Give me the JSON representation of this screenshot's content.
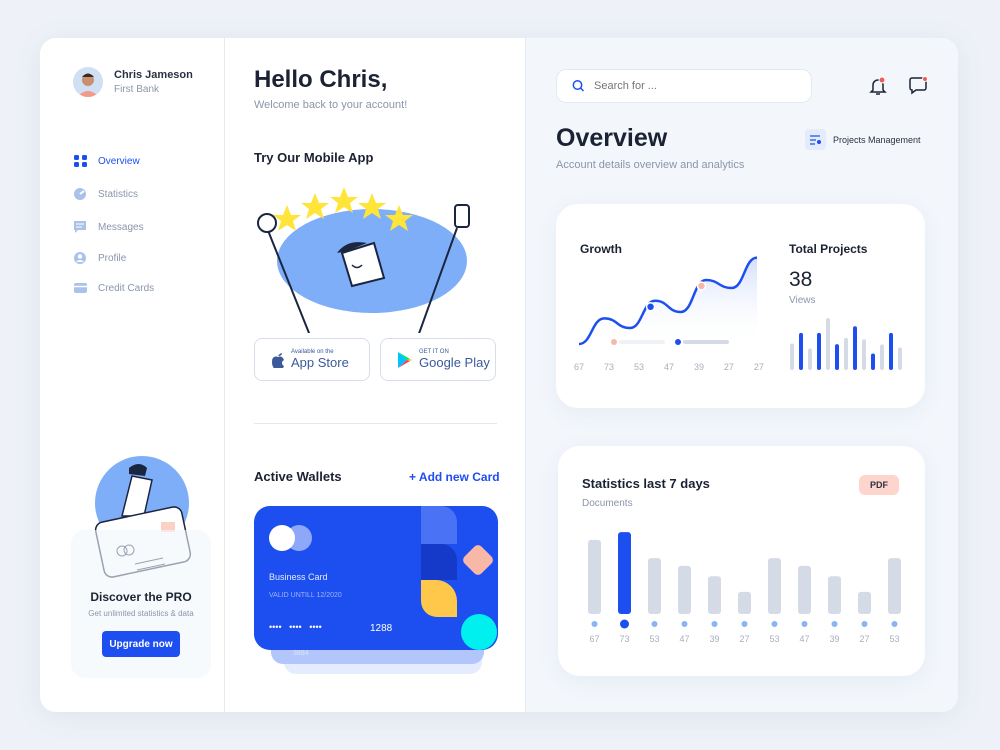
{
  "user": {
    "name": "Chris Jameson",
    "bank": "First Bank"
  },
  "sidebar": {
    "items": [
      {
        "label": "Overview",
        "icon": "grid-icon",
        "active": true
      },
      {
        "label": "Statistics",
        "icon": "pie-chart-icon"
      },
      {
        "label": "Messages",
        "icon": "message-icon"
      },
      {
        "label": "Profile",
        "icon": "user-icon"
      },
      {
        "label": "Credit Cards",
        "icon": "credit-card-icon"
      }
    ],
    "promo": {
      "title": "Discover the PRO",
      "subtitle": "Get unlimited statistics & data",
      "button": "Upgrade now"
    }
  },
  "main": {
    "title": "Hello Chris,",
    "subtitle": "Welcome back to your account!",
    "app_section": "Try Our Mobile App",
    "app_store": {
      "small": "Available on the",
      "big": "App Store"
    },
    "google_play": {
      "small": "GET IT ON",
      "big": "Google Play"
    },
    "wallets_title": "Active Wallets",
    "add_card": "+ Add new Card",
    "card": {
      "name": "Business Card",
      "valid": "VALID UNTILL 12/2020",
      "masked": "••••   ••••   ••••",
      "last4": "1288",
      "back_last4": "3894"
    }
  },
  "colors": {
    "accent": "#1d4ff0",
    "pdf_badge": "#fdd5cc",
    "cyan": "#00f0f0",
    "yellow": "#ffc84a",
    "peach": "#f8b8a8"
  },
  "header": {
    "search_placeholder": "Search for ...",
    "notifications_icon": "bell-icon",
    "messages_icon": "chat-icon"
  },
  "overview": {
    "title": "Overview",
    "subtitle": "Account details overview and analytics",
    "projects_button": "Projects Management"
  },
  "chart_data": [
    {
      "type": "line",
      "title": "Growth",
      "x_labels": [
        "67",
        "73",
        "53",
        "47",
        "39",
        "27",
        "27"
      ],
      "values": [
        10,
        42,
        30,
        64,
        50,
        90,
        80,
        118
      ],
      "markers": [
        {
          "index": 3,
          "color": "#1d4ff0"
        },
        {
          "index": 5,
          "color": "#f8b8a8"
        }
      ]
    },
    {
      "type": "bar",
      "title": "Total Projects",
      "value_label": "38",
      "unit_label": "Views",
      "values": [
        80,
        112,
        65,
        112,
        157,
        78,
        97,
        132,
        93,
        50,
        77,
        112,
        68
      ],
      "highlight": [
        1,
        3,
        5,
        7,
        9,
        11
      ]
    },
    {
      "type": "bar",
      "title": "Statistics last 7 days",
      "subtitle": "Documents",
      "badge": "PDF",
      "categories": [
        "67",
        "73",
        "53",
        "47",
        "39",
        "27",
        "53",
        "47",
        "39",
        "27",
        "53"
      ],
      "values": [
        67,
        73,
        53,
        47,
        39,
        27,
        53,
        47,
        39,
        27,
        53
      ],
      "highlight_index": 1
    }
  ]
}
